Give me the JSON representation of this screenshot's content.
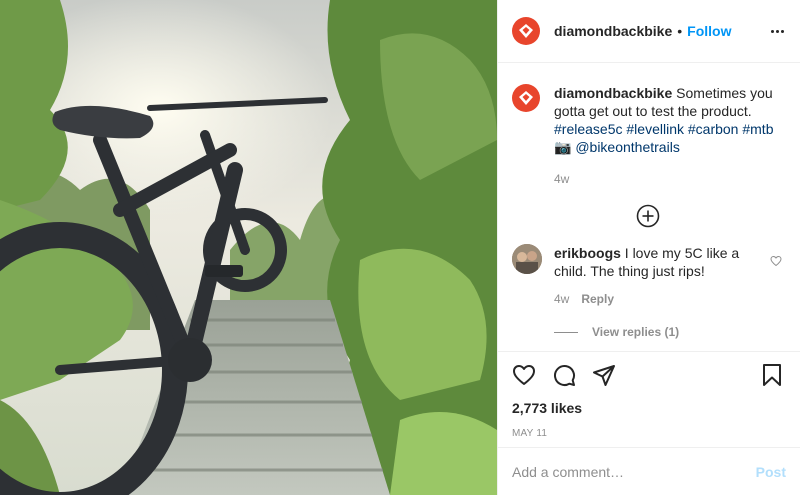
{
  "post": {
    "username": "diamondbackbike",
    "separator": "•",
    "follow_label": "Follow",
    "more_label": "More options",
    "photo_alt": "Mountain bike on a wooden trail bridge"
  },
  "caption": {
    "username": "diamondbackbike",
    "text": "Sometimes you gotta get out to test the product.",
    "tags": [
      "#release5c",
      "#levellink",
      "#carbon",
      "#mtb"
    ],
    "emoji": "📷",
    "mention": "@bikeonthetrails",
    "time": "4w"
  },
  "comments": [
    {
      "username": "erikboogs",
      "text": "I love my 5C like a child. The thing just rips!",
      "time": "4w",
      "reply_label": "Reply",
      "view_replies": "View replies (1)"
    }
  ],
  "actions": {
    "icons": [
      "heart-icon",
      "comment-icon",
      "share-icon",
      "bookmark-icon"
    ]
  },
  "likes": "2,773 likes",
  "date": "MAY 11",
  "add_comment": {
    "placeholder": "Add a comment…",
    "post_label": "Post"
  },
  "colors": {
    "brand_avatar": "#e8452c",
    "link": "#0095f6",
    "hashtag": "#00376b",
    "muted": "#8e8e8e",
    "post_disabled": "#b2dffc"
  }
}
